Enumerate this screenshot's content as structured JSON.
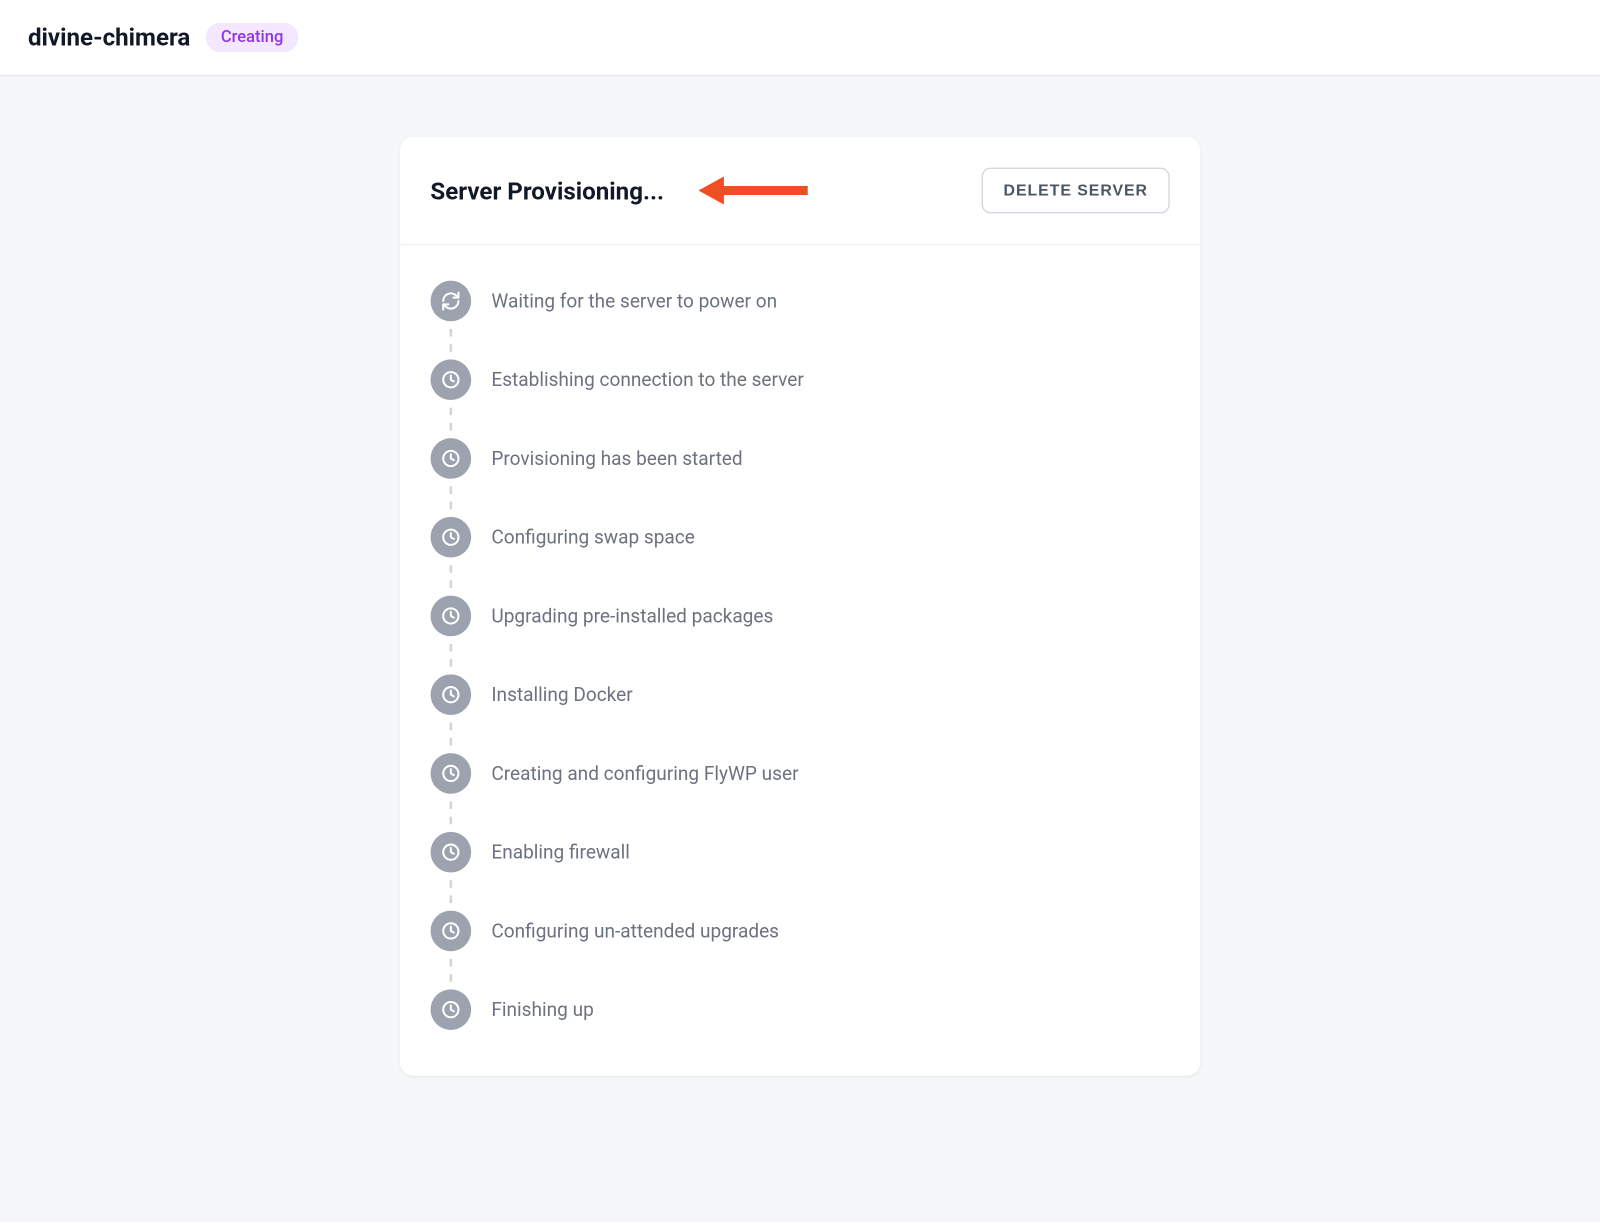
{
  "header": {
    "server_name": "divine-chimera",
    "status": "Creating"
  },
  "card": {
    "title": "Server Provisioning...",
    "delete_label": "DELETE SERVER"
  },
  "steps": [
    {
      "label": "Waiting for the server to power on",
      "icon": "refresh"
    },
    {
      "label": "Establishing connection to the server",
      "icon": "clock"
    },
    {
      "label": "Provisioning has been started",
      "icon": "clock"
    },
    {
      "label": "Configuring swap space",
      "icon": "clock"
    },
    {
      "label": "Upgrading pre-installed packages",
      "icon": "clock"
    },
    {
      "label": "Installing Docker",
      "icon": "clock"
    },
    {
      "label": "Creating and configuring FlyWP user",
      "icon": "clock"
    },
    {
      "label": "Enabling firewall",
      "icon": "clock"
    },
    {
      "label": "Configuring un-attended upgrades",
      "icon": "clock"
    },
    {
      "label": "Finishing up",
      "icon": "clock"
    }
  ],
  "colors": {
    "badge_bg": "#f3e8ff",
    "badge_text": "#9333ea",
    "step_icon_bg": "#9ca3af",
    "arrow": "#f04e23"
  }
}
